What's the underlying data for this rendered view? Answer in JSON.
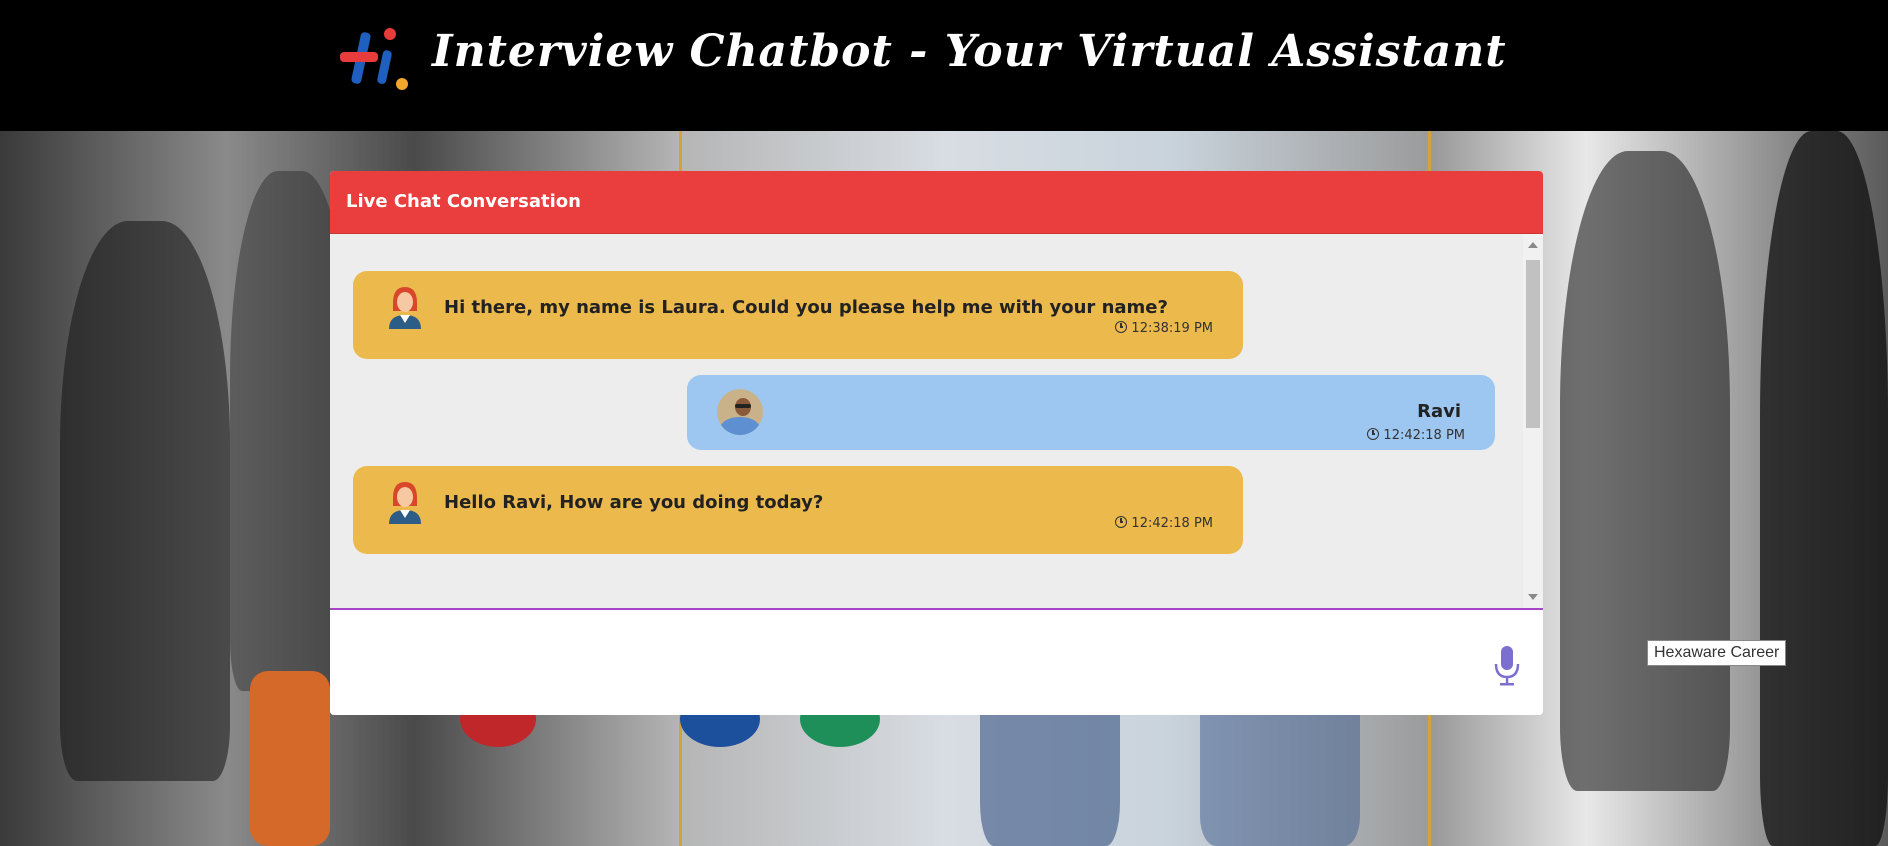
{
  "header": {
    "title": "Interview Chatbot - Your Virtual Assistant",
    "logo_icon": "hexaware-hi-logo"
  },
  "chat": {
    "heading": "Live Chat Conversation",
    "messages": [
      {
        "sender": "bot",
        "avatar_icon": "female-agent-icon",
        "text": "Hi there, my name is Laura. Could you please help me with your name?",
        "time": "12:38:19 PM"
      },
      {
        "sender": "user",
        "avatar_icon": "user-photo",
        "text": "Ravi",
        "time": "12:42:18 PM"
      },
      {
        "sender": "bot",
        "avatar_icon": "female-agent-icon",
        "text": "Hello Ravi, How are you doing today?",
        "time": "12:42:18 PM"
      }
    ],
    "input": {
      "value": "",
      "placeholder": ""
    },
    "mic_icon": "microphone-icon"
  },
  "tooltip": "Hexaware Career",
  "colors": {
    "header_bg": "#000000",
    "chat_head": "#ea3d3d",
    "bot_bubble": "#ebb94c",
    "user_bubble": "#9dc7f0",
    "input_border": "#a646c7",
    "mic": "#7b6fd0"
  }
}
